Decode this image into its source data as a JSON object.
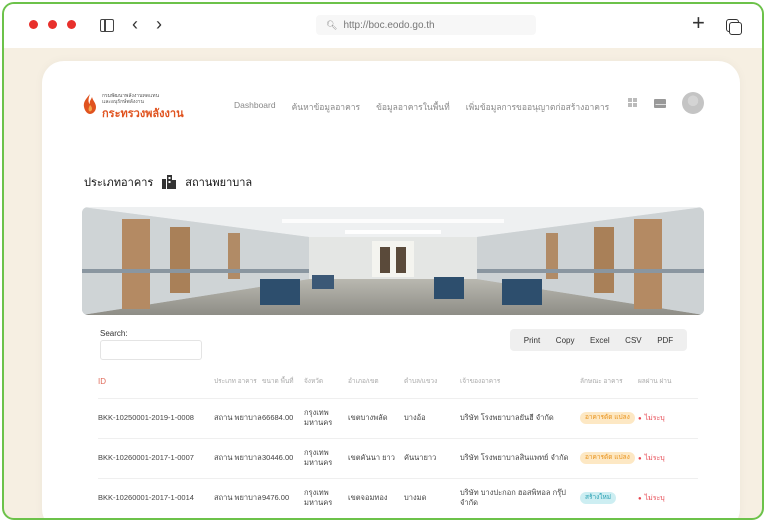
{
  "browser": {
    "url": "http://boc.eodo.go.th"
  },
  "logo": {
    "line1": "กรมพัฒนาพลังงานทดแทน",
    "line2": "และอนุรักษ์พลังงาน",
    "line3": "กระทรวงพลังงาน"
  },
  "nav": {
    "items": [
      {
        "label": "Dashboard"
      },
      {
        "label": "ค้นหาข้อมูลอาคาร"
      },
      {
        "label": "ข้อมูลอาคารในพื้นที่"
      },
      {
        "label": "เพิ่มข้อมูลการขออนุญาตก่อสร้างอาคาร"
      }
    ]
  },
  "building_type": {
    "label": "ประเภทอาคาร",
    "value": "สถานพยาบาล"
  },
  "toolbar": {
    "search_label": "Search:",
    "print": "Print",
    "copy": "Copy",
    "excel": "Excel",
    "csv": "CSV",
    "pdf": "PDF"
  },
  "table": {
    "headers": {
      "id": "ID",
      "type": "ประเภท อาคาร",
      "area": "ขนาด พื้นที่",
      "province": "จังหวัด",
      "district": "อำเภอ/เขต",
      "subdistrict": "ตำบล/แขวง",
      "owner": "เจ้าของอาคาร",
      "building_status": "ลักษณะ อาคาร",
      "result": "ผลผ่าน ผ่าน"
    },
    "rows": [
      {
        "id": "BKK-10250001-2019-1-0008",
        "type": "สถาน พยาบาล",
        "area": "66684.00",
        "province": "กรุงเทพ มหานคร",
        "district": "เขตบางพลัด",
        "subdistrict": "บางอ้อ",
        "owner": "บริษัท โรงพยาบาลยันฮี จำกัด",
        "badge": "อาคารดัด แปลง",
        "badge_color": "#fde8c4",
        "status": "ไม่ระบุ"
      },
      {
        "id": "BKK-10260001-2017-1-0007",
        "type": "สถาน พยาบาล",
        "area": "30446.00",
        "province": "กรุงเทพ มหานคร",
        "district": "เขตคันนา ยาว",
        "subdistrict": "คันนายาว",
        "owner": "บริษัท โรงพยาบาลสินแพทย์ จำกัด",
        "badge": "อาคารดัด แปลง",
        "badge_color": "#fde8c4",
        "status": "ไม่ระบุ"
      },
      {
        "id": "BKK-10260001-2017-1-0014",
        "type": "สถาน พยาบาล",
        "area": "9476.00",
        "province": "กรุงเทพ มหานคร",
        "district": "เขตจอมทอง",
        "subdistrict": "บางมด",
        "owner": "บริษัท บางปะกอก ฮอสพิทอล กรุ๊ป จำกัด",
        "badge": "สร้างใหม่",
        "badge_color": "#cdeef2",
        "status": "ไม่ระบุ"
      }
    ]
  },
  "colors": {
    "frame_border": "#6cc24a",
    "window_dot": "#e8302c",
    "logo_orange": "#e0531f",
    "status_red": "#e6454f"
  }
}
